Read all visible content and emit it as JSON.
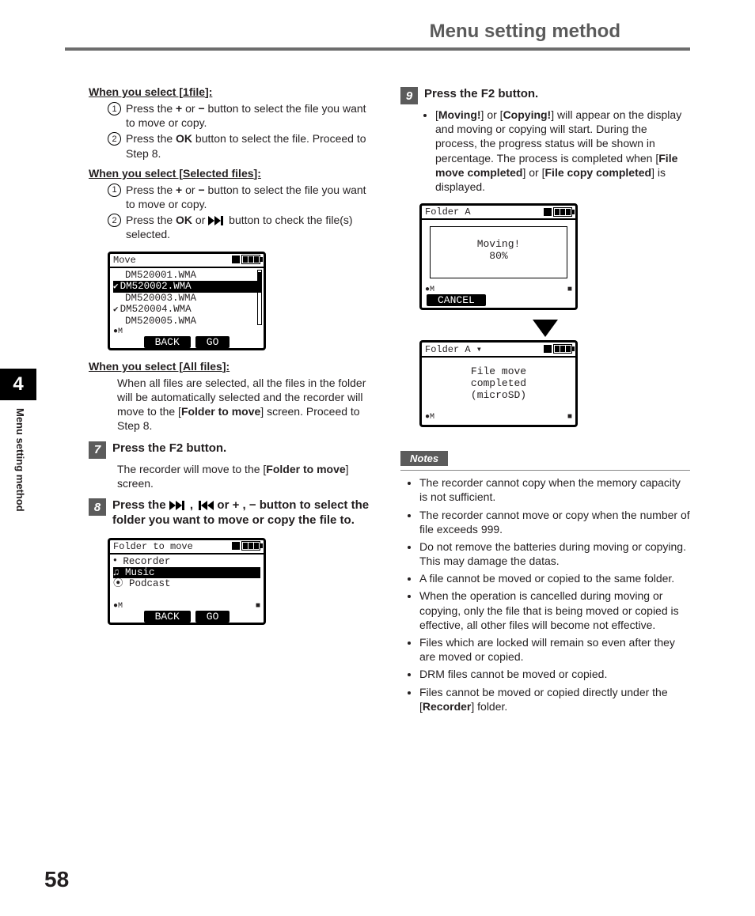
{
  "header": {
    "title": "Menu setting method"
  },
  "sideTab": {
    "chapter": "4",
    "label": "Menu setting method"
  },
  "pageNumber": "58",
  "left": {
    "sel1file": {
      "heading_prefix": "When you select [",
      "heading_keyword": "1file",
      "heading_suffix": "]:",
      "s1_a": "Press the ",
      "s1_plus": "+",
      "s1_or": " or ",
      "s1_minus": "−",
      "s1_b": " button to select the file you want to move or copy.",
      "s2_a": "Press the ",
      "s2_ok": "OK",
      "s2_b": " button to select the file. Proceed to Step 8."
    },
    "selSelected": {
      "heading_prefix": "When you select [",
      "heading_keyword": "Selected files",
      "heading_suffix": "]:",
      "s1_a": "Press the ",
      "s1_plus": "+",
      "s1_or": " or ",
      "s1_minus": "−",
      "s1_b": " button to select the file you want to move or copy.",
      "s2_a": "Press the ",
      "s2_ok": "OK",
      "s2_or": " or ",
      "s2_b": " button to check the file(s) selected."
    },
    "lcd1": {
      "title": "Move",
      "files": [
        "DM520001.WMA",
        "DM520002.WMA",
        "DM520003.WMA",
        "DM520004.WMA",
        "DM520005.WMA"
      ],
      "checked": [
        false,
        true,
        false,
        true,
        false
      ],
      "highlighted": 1,
      "left_soft": "BACK",
      "right_soft": "GO",
      "rec_indicator": "●M"
    },
    "selAll": {
      "heading_prefix": "When you select [",
      "heading_keyword": "All files",
      "heading_suffix": "]:",
      "body_a": "When all files are selected, all the files in the folder will be automatically selected and the recorder will move to the [",
      "body_bold": "Folder to move",
      "body_b": "] screen. Proceed to Step 8."
    },
    "step7": {
      "num": "7",
      "title": "Press the F2 button.",
      "body_a": "The recorder will move to the [",
      "body_bold": "Folder to move",
      "body_b": "] screen."
    },
    "step8": {
      "num": "8",
      "title_a": "Press the ",
      "title_mid": " , ",
      "title_b": " or + , − button to select the folder you want to move or copy the file to."
    },
    "lcd2": {
      "title": "Folder to move",
      "items": [
        "Recorder",
        "Music",
        "Podcast"
      ],
      "highlighted": 1,
      "left_soft": "BACK",
      "right_soft": "GO",
      "rec_indicator": "●M"
    }
  },
  "right": {
    "step9": {
      "num": "9",
      "title": "Press the F2 button.",
      "bullet_a1": "[",
      "bullet_b1": "Moving!",
      "bullet_a2": "] or [",
      "bullet_b2": "Copying!",
      "bullet_a3": "] will appear on the display and moving or copying will start. During the process, the progress status will be shown in percentage. The process is completed when [",
      "bullet_b3": "File move completed",
      "bullet_a4": "] or [",
      "bullet_b4": "File copy completed",
      "bullet_a5": "] is displayed."
    },
    "lcd3": {
      "title": "Folder A",
      "line1": "Moving!",
      "line2": "80%",
      "soft": "CANCEL",
      "rec_indicator": "●M"
    },
    "lcd4": {
      "title": "Folder A",
      "line1": "File move",
      "line2": "completed",
      "line3": "(microSD)",
      "rec_indicator": "●M"
    },
    "notesLabel": "Notes",
    "notes": {
      "n1": "The recorder cannot copy when the memory capacity is not sufficient.",
      "n2": "The recorder cannot move or copy when the number of file exceeds 999.",
      "n3": "Do not remove the batteries during moving or copying. This may damage the datas.",
      "n4": "A file cannot be moved or copied to the same folder.",
      "n5": "When the operation is cancelled during moving or copying, only the file that is being moved or copied is effective, all other files will become not effective.",
      "n6": "Files which are locked will remain so even after they are moved or copied.",
      "n7": "DRM files cannot be moved or copied.",
      "n8a": "Files cannot be moved or copied directly under the [",
      "n8b": "Recorder",
      "n8c": "] folder."
    }
  }
}
